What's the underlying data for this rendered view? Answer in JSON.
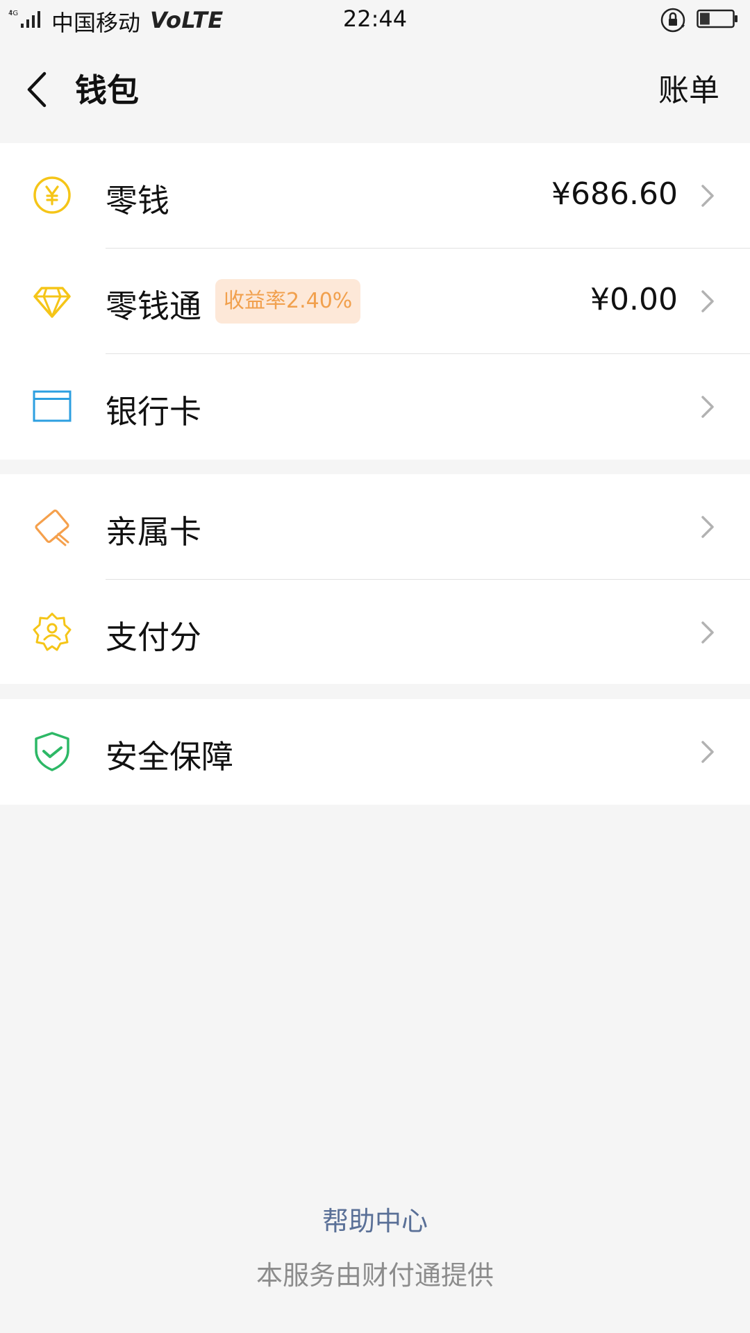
{
  "status_bar": {
    "network_type": "4G",
    "carrier": "中国移动",
    "volte": "VoLTE",
    "time": "22:44",
    "battery_level": 0.3
  },
  "nav": {
    "title": "钱包",
    "right_label": "账单"
  },
  "groups": [
    {
      "items": [
        {
          "label": "零钱",
          "amount": "¥686.60",
          "icon": "yuan-coin-icon"
        },
        {
          "label": "零钱通",
          "badge": "收益率2.40%",
          "amount": "¥0.00",
          "icon": "diamond-icon"
        },
        {
          "label": "银行卡",
          "icon": "bank-card-icon"
        }
      ]
    },
    {
      "items": [
        {
          "label": "亲属卡",
          "icon": "family-card-icon"
        },
        {
          "label": "支付分",
          "icon": "pay-score-icon"
        }
      ]
    },
    {
      "items": [
        {
          "label": "安全保障",
          "icon": "security-shield-icon"
        }
      ]
    }
  ],
  "footer": {
    "help_link": "帮助中心",
    "provider_text": "本服务由财付通提供"
  },
  "colors": {
    "background": "#f5f5f5",
    "yellow_icon": "#f5c518",
    "card_icon": "#2d9fe0",
    "orange_icon": "#f5a04c",
    "shield_icon": "#2db866",
    "badge_text": "#f1a04d",
    "badge_bg": "#fde8d8",
    "help_link": "#5a7097"
  }
}
